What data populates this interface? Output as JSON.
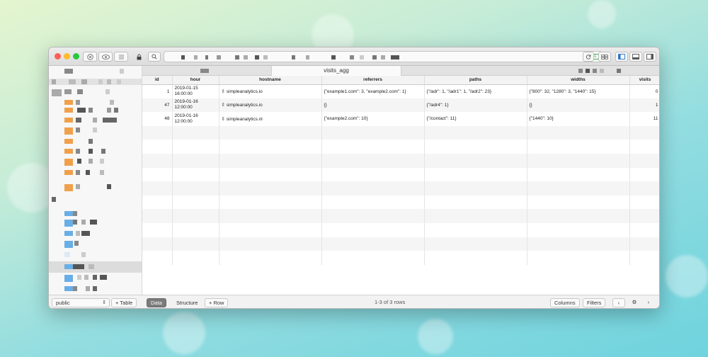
{
  "window": {
    "ssl_badge": "SSL"
  },
  "tabs": {
    "active": "visits_agg"
  },
  "table": {
    "columns": [
      "id",
      "hour",
      "hostname",
      "referrers",
      "paths",
      "widths",
      "visits"
    ],
    "rows": [
      [
        "1",
        "2019-01-15\n16:00:00",
        "simpleanalytics.io",
        "{\"example1.com\": 3, \"example2.com\": 1}",
        "{\"/adr\": 1, \"/adr1\": 1, \"/adr2\": 23}",
        "{\"800\": 32, \"1280\": 3, \"1440\": 15}",
        "0"
      ],
      [
        "47",
        "2019-01-16\n12:00:00",
        "simpleanalytics.io",
        "{}",
        "{\"/adr4\": 1}",
        "{}",
        "1"
      ],
      [
        "48",
        "2019-01-16\n12:00:00",
        "simpleanalytics.nl",
        "{\"example2.com\": 10}",
        "{\"/contact\": 11}",
        "{\"1440\": 10}",
        "11"
      ]
    ]
  },
  "sidebar": {
    "schema_value": "public",
    "add_table_label": "+ Table"
  },
  "bottom": {
    "data_tab": "Data",
    "structure_tab": "Structure",
    "add_row": "+ Row",
    "row_count": "1-3 of 3 rows",
    "columns_button": "Columns",
    "filters_button": "Filters"
  },
  "colors": {
    "accent_orange": "#f0a04b",
    "accent_blue": "#6aaee6",
    "close": "#fc5f57",
    "minimize": "#fdbc2e",
    "zoom": "#28c840"
  },
  "icons": [
    "close-icon",
    "eye-icon",
    "list-icon",
    "lock-icon",
    "search-icon",
    "reload-icon",
    "grid-icon",
    "sidebar-left-icon",
    "panel-bottom-icon",
    "panel-right-icon",
    "gear-icon",
    "chevron-left-icon",
    "chevron-right-icon",
    "sort-icon"
  ]
}
